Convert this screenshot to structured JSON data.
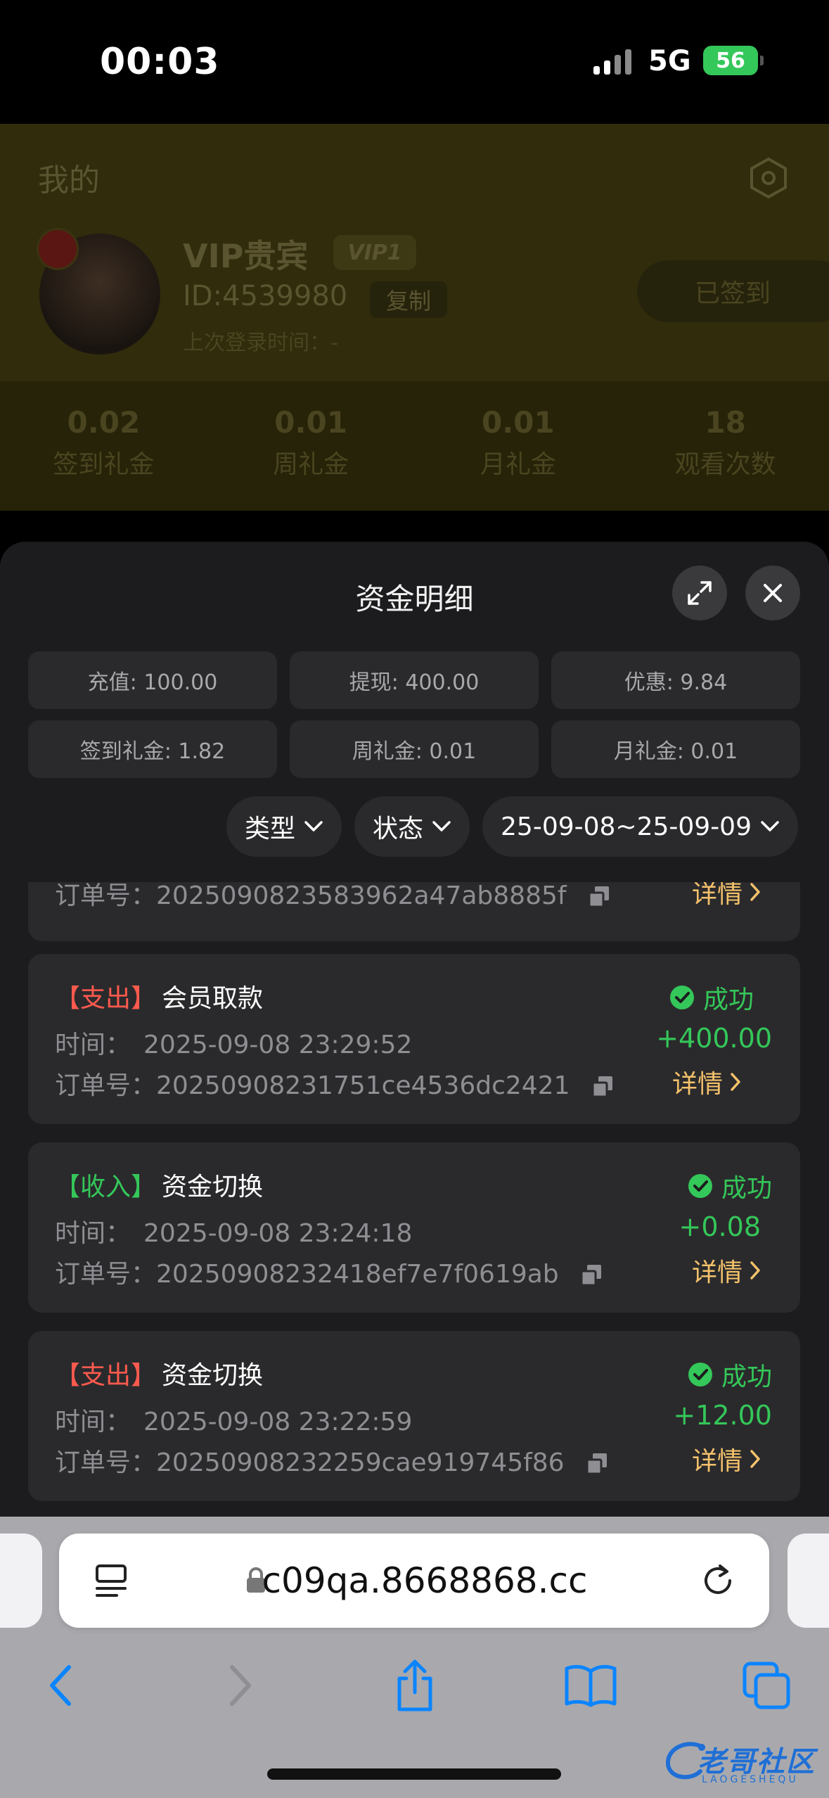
{
  "status_bar": {
    "time": "00:03",
    "network": "5G",
    "battery": "56"
  },
  "background_page": {
    "title": "我的",
    "vip_name": "VIP贵宾",
    "vip_badge": "VIP1",
    "user_id": "ID:4539980",
    "copy_label": "复制",
    "last_login": "上次登录时间：-",
    "signed_label": "已签到",
    "stats": [
      {
        "value": "0.02",
        "label": "签到礼金"
      },
      {
        "value": "0.01",
        "label": "周礼金"
      },
      {
        "value": "0.01",
        "label": "月礼金"
      },
      {
        "value": "18",
        "label": "观看次数"
      }
    ]
  },
  "sheet": {
    "title": "资金明细",
    "summary": [
      "充值: 100.00",
      "提现: 400.00",
      "优惠: 9.84",
      "签到礼金: 1.82",
      "周礼金: 0.01",
      "月礼金: 0.01"
    ],
    "filters": {
      "type": "类型",
      "status": "状态",
      "date_range": "25-09-08~25-09-09"
    },
    "partial_record": {
      "order_label": "订单号：",
      "order_no": "2025090823583962a47ab8885f",
      "detail": "详情"
    },
    "records": [
      {
        "tag": "【支出】",
        "tag_kind": "out",
        "name": "会员取款",
        "time_label": "时间：",
        "time": "2025-09-08 23:29:52",
        "order_label": "订单号：",
        "order_no": "20250908231751ce4536dc2421",
        "status": "成功",
        "amount": "+400.00",
        "detail": "详情"
      },
      {
        "tag": "【收入】",
        "tag_kind": "in",
        "name": "资金切换",
        "time_label": "时间：",
        "time": "2025-09-08 23:24:18",
        "order_label": "订单号：",
        "order_no": "20250908232418ef7e7f0619ab",
        "status": "成功",
        "amount": "+0.08",
        "detail": "详情"
      },
      {
        "tag": "【支出】",
        "tag_kind": "out",
        "name": "资金切换",
        "time_label": "时间：",
        "time": "2025-09-08 23:22:59",
        "order_label": "订单号：",
        "order_no": "20250908232259cae919745f86",
        "status": "成功",
        "amount": "+12.00",
        "detail": "详情"
      }
    ]
  },
  "browser": {
    "url": "c09qa.8668868.cc"
  },
  "watermark": {
    "text": "老哥社区",
    "sub": "LAOGESHEQU"
  },
  "colors": {
    "success": "#34c759",
    "expense_tag": "#ff5a4e",
    "detail_link": "#f5c26b",
    "sheet_bg": "#1c1c1e",
    "card_bg": "#2a2a2c",
    "ios_blue": "#0a84ff"
  }
}
